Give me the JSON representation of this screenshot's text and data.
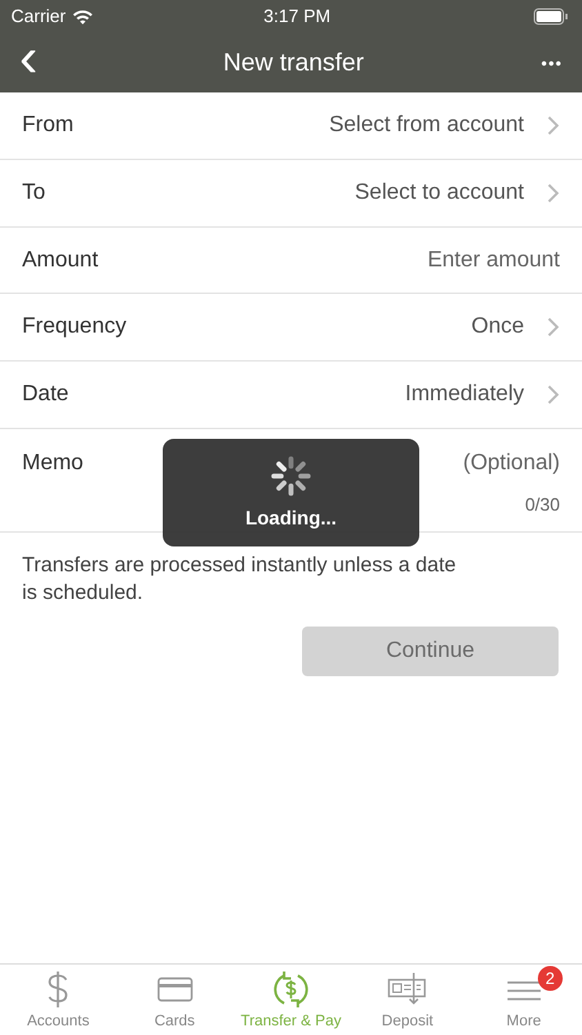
{
  "status_bar": {
    "carrier": "Carrier",
    "time": "3:17 PM"
  },
  "nav_bar": {
    "back": "‹",
    "title": "New transfer",
    "more": "•••"
  },
  "form_rows": [
    {
      "kind": "select",
      "label": "From",
      "value": "Select from account"
    },
    {
      "kind": "select",
      "label": "To",
      "value": "Select to account"
    },
    {
      "kind": "input",
      "label": "Amount",
      "placeholder": "Enter amount"
    },
    {
      "kind": "select",
      "label": "Frequency",
      "value": "Once"
    },
    {
      "kind": "select",
      "label": "Date",
      "value": "Immediately"
    },
    {
      "kind": "memo",
      "label": "Memo",
      "placeholder": "(Optional)",
      "counter": "0/30"
    }
  ],
  "note": "Transfers are processed instantly unless a date is scheduled.",
  "continue_button": {
    "label": "Continue",
    "disabled": true
  },
  "loading": {
    "label": "Loading..."
  },
  "tab_bar": [
    {
      "kind": "dollar",
      "label": "Accounts",
      "selected": false
    },
    {
      "kind": "card",
      "label": "Cards",
      "selected": false
    },
    {
      "kind": "transfer",
      "label": "Transfer & Pay",
      "selected": true
    },
    {
      "kind": "deposit",
      "label": "Deposit",
      "selected": false
    },
    {
      "kind": "more",
      "label": "More",
      "selected": false,
      "badge": "2"
    }
  ]
}
